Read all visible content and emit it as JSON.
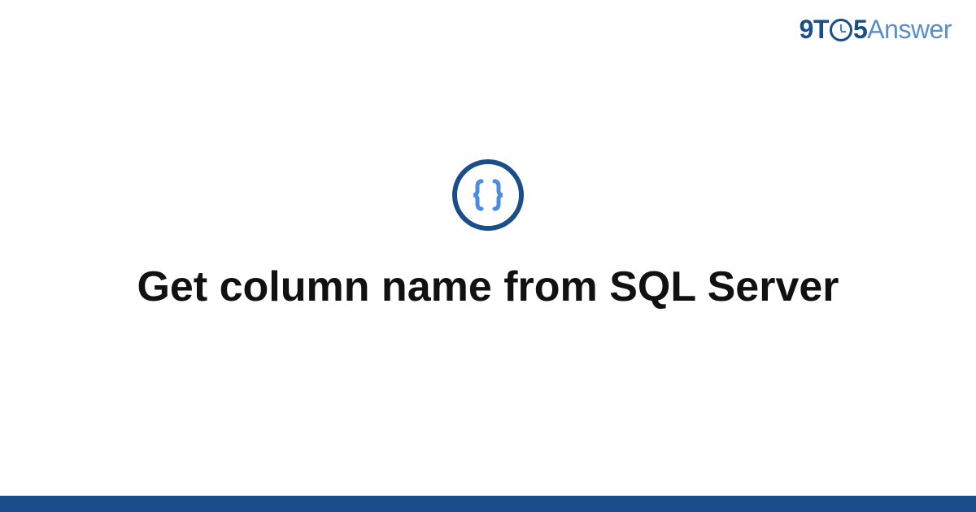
{
  "brand": {
    "prefix": "9T",
    "middle": "5",
    "suffix": "Answer"
  },
  "content": {
    "title": "Get column name from SQL Server",
    "icon": "braces-icon"
  },
  "colors": {
    "brand_primary": "#1a4e8a",
    "brand_secondary": "#5a8dc9",
    "icon_fill": "#4a8de0"
  }
}
